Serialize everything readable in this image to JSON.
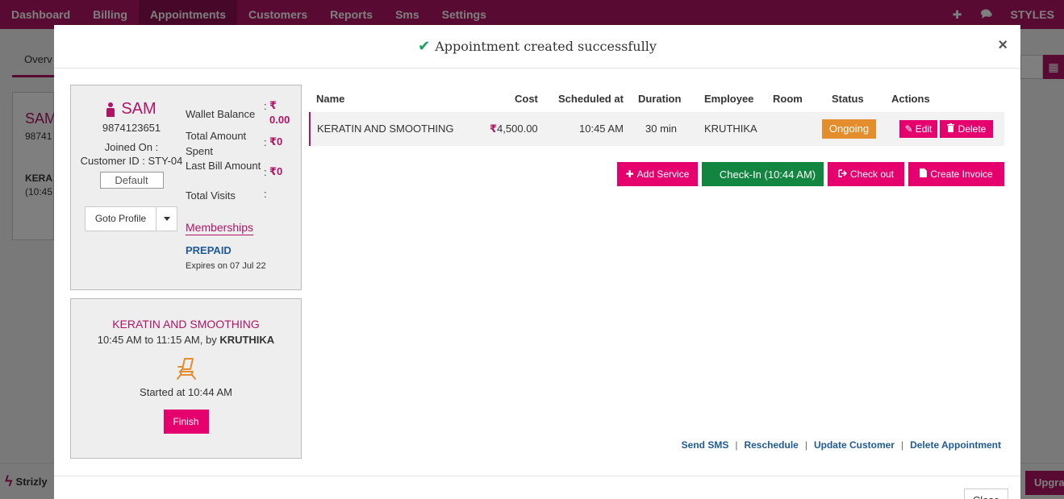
{
  "topnav": {
    "items": [
      "Dashboard",
      "Billing",
      "Appointments",
      "Customers",
      "Reports",
      "Sms",
      "Settings"
    ],
    "active": "Appointments",
    "brand": "STYLES"
  },
  "background": {
    "tab_label": "Overv",
    "card_name": "SAM",
    "card_phone": "98741",
    "card_service": "KERA",
    "card_time": "(10:45",
    "logo_text": "Strizly",
    "upgrade_label": "Upgra"
  },
  "modal": {
    "title": "Appointment created successfully",
    "close_symbol": "×",
    "customer": {
      "name": "SAM",
      "phone": "9874123651",
      "joined_on": "Joined On :",
      "customer_id": "Customer ID : STY-04",
      "default_label": "Default",
      "goto_profile_label": "Goto Profile",
      "stats": [
        {
          "label": "Wallet Balance",
          "value": "0.00"
        },
        {
          "label": "Total Amount Spent",
          "value": "0"
        },
        {
          "label": "Last Bill Amount",
          "value": "0"
        },
        {
          "label": "Total Visits",
          "value": ""
        }
      ],
      "colon": ":",
      "memberships_label": "Memberships",
      "membership_type": "PREPAID",
      "membership_expiry": "Expires on 07 Jul 22"
    },
    "service_card": {
      "name": "KERATIN AND SMOOTHING",
      "time_prefix": "10:45 AM to 11:15 AM, by ",
      "employee": "KRUTHIKA",
      "started": "Started at 10:44 AM",
      "finish_label": "Finish"
    },
    "table": {
      "headers": [
        "Name",
        "Cost",
        "Scheduled at",
        "Duration",
        "Employee",
        "Room",
        "Status",
        "Actions"
      ],
      "rows": [
        {
          "name": "KERATIN AND SMOOTHING",
          "cost": "4,500.00",
          "scheduled": "10:45 AM",
          "duration": "30 min",
          "employee": "KRUTHIKA",
          "room": "",
          "status": "Ongoing",
          "edit_label": "Edit",
          "delete_label": "Delete"
        }
      ]
    },
    "actions": {
      "add_service": "Add Service",
      "check_in": "Check-In (10:44 AM)",
      "check_out": "Check out",
      "create_invoice": "Create Invoice"
    },
    "links": {
      "send_sms": "Send SMS",
      "reschedule": "Reschedule",
      "update_customer": "Update Customer",
      "delete_appointment": "Delete Appointment",
      "separator": "|"
    },
    "footer": {
      "close_label": "Close"
    }
  },
  "colors": {
    "brand": "#b01565",
    "accent_button": "#e6006e",
    "checkin_green": "#128540",
    "status_ongoing": "#e38d2d",
    "link_blue": "#1f5a96",
    "success_check": "#19a15f"
  }
}
